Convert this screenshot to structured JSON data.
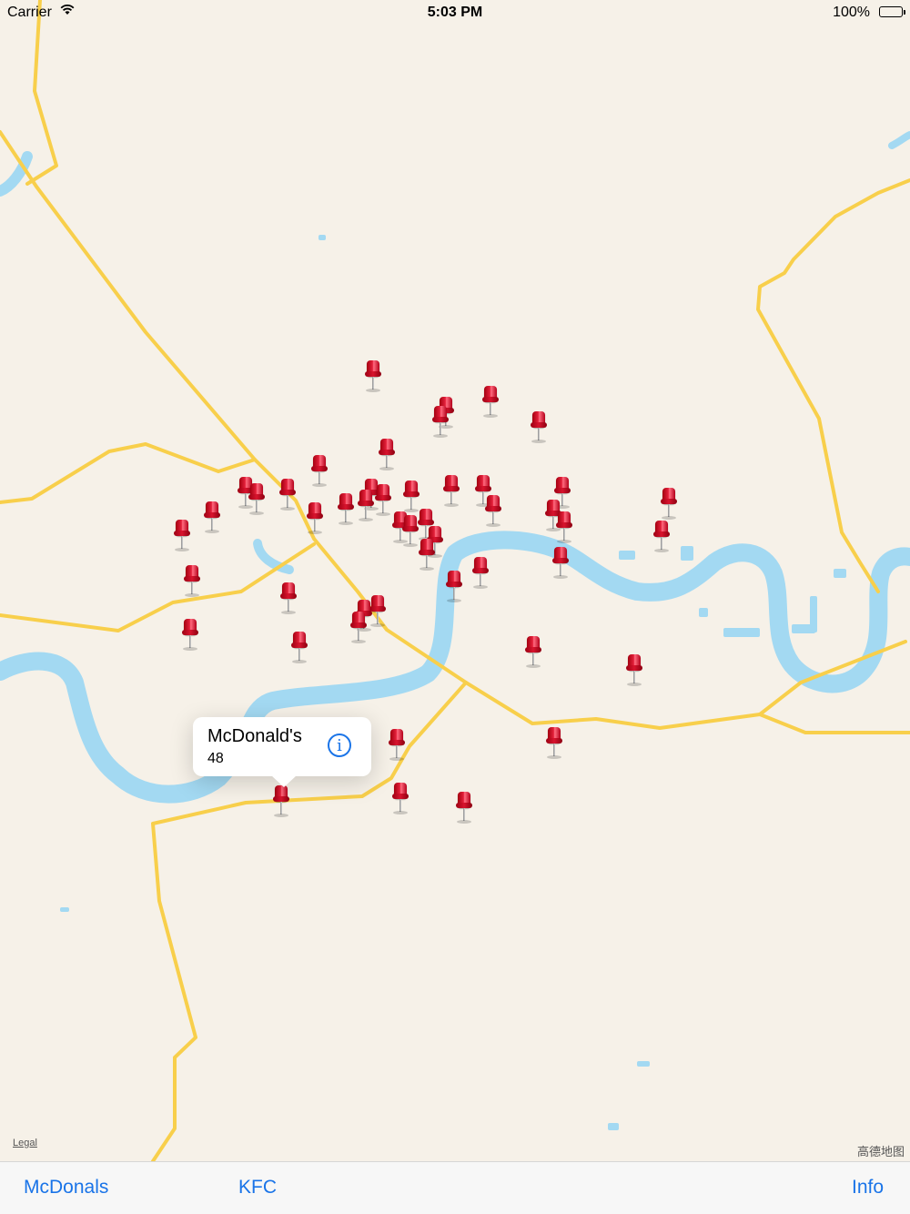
{
  "status_bar": {
    "carrier": "Carrier",
    "time": "5:03 PM",
    "battery": "100%"
  },
  "callout": {
    "title": "McDonald's",
    "subtitle": "48",
    "icon": "info-icon"
  },
  "map": {
    "legal": "Legal",
    "attribution": "高德地图",
    "pin_count": 52
  },
  "toolbar": {
    "mcdonals": "McDonals",
    "kfc": "KFC",
    "info": "Info"
  },
  "colors": {
    "land": "#f6f1e8",
    "road": "#f8cf4b",
    "water": "#a3d9f2",
    "pin": "#d9122c",
    "accent": "#1a74e8"
  }
}
